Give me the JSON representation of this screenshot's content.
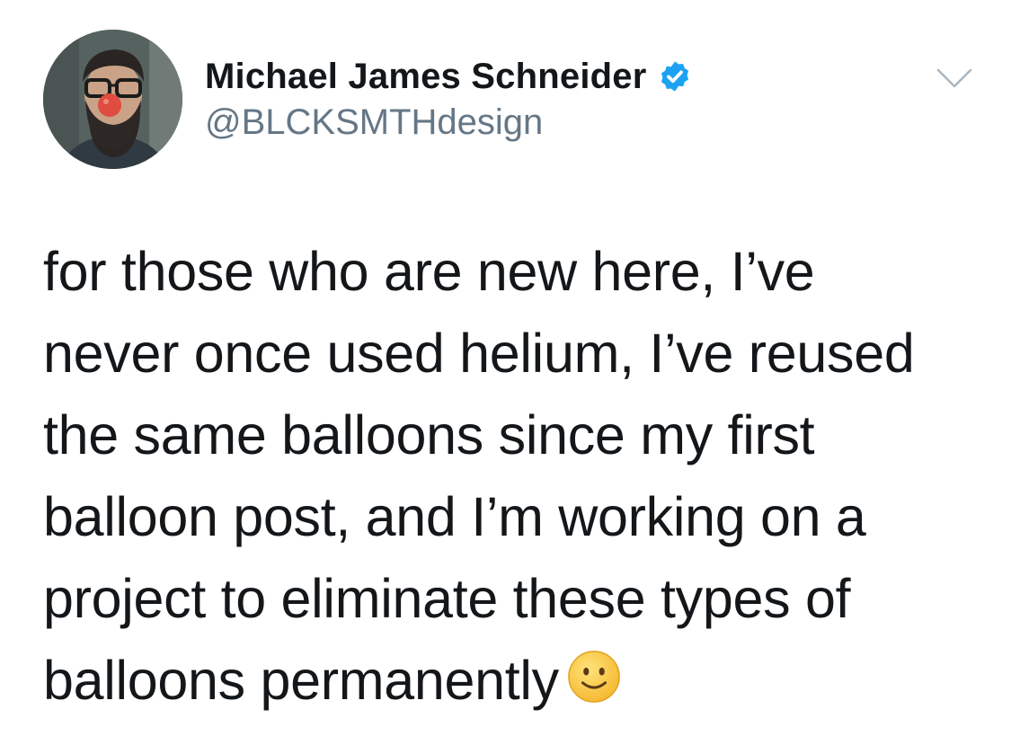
{
  "author": {
    "display_name": "Michael James Schneider",
    "handle": "@BLCKSMTHdesign",
    "verified": true,
    "verified_icon": "verified-badge-icon",
    "verified_color": "#1da1f2"
  },
  "menu": {
    "icon": "chevron-down-icon"
  },
  "tweet": {
    "lines": [
      "for those who are new here, I’ve",
      "never once used helium, I’ve reused",
      "the same balloons since my first",
      "balloon post, and I’m working on a",
      "project to eliminate these types of",
      "balloons permanently"
    ],
    "emoji": "slightly-smiling-face-emoji"
  },
  "colors": {
    "text": "#14171a",
    "secondary": "#657786",
    "background": "#ffffff"
  }
}
